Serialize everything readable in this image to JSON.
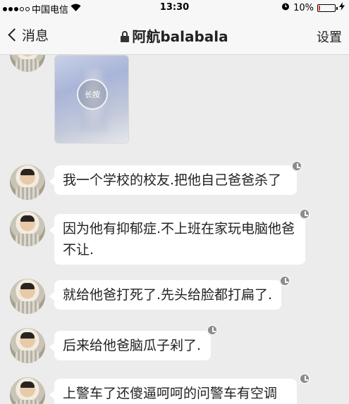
{
  "status_bar": {
    "carrier": "中国电信",
    "time": "13:30",
    "battery": "10%",
    "battery_level": 0.1,
    "battery_color": "#e0302a"
  },
  "nav": {
    "back_label": "消息",
    "title": "阿航balabala",
    "settings_label": "设置"
  },
  "messages": [
    {
      "type": "image",
      "overlay_text": "长按"
    },
    {
      "type": "text",
      "text": "我一个学校的校友.把他自己爸爸杀了"
    },
    {
      "type": "text",
      "text": "因为他有抑郁症.不上班在家玩电脑他爸不让."
    },
    {
      "type": "text",
      "text": "就给他爸打死了.先头给脸都打扁了."
    },
    {
      "type": "text",
      "text": "后来给他爸脑瓜子剁了."
    },
    {
      "type": "text",
      "text": "上警车了还傻逼呵呵的问警车有空调"
    }
  ],
  "icons": {
    "wifi": "wifi-icon",
    "alarm": "alarm-icon",
    "charging": "bolt-icon",
    "lock": "lock-icon",
    "pending": "clock-icon"
  }
}
